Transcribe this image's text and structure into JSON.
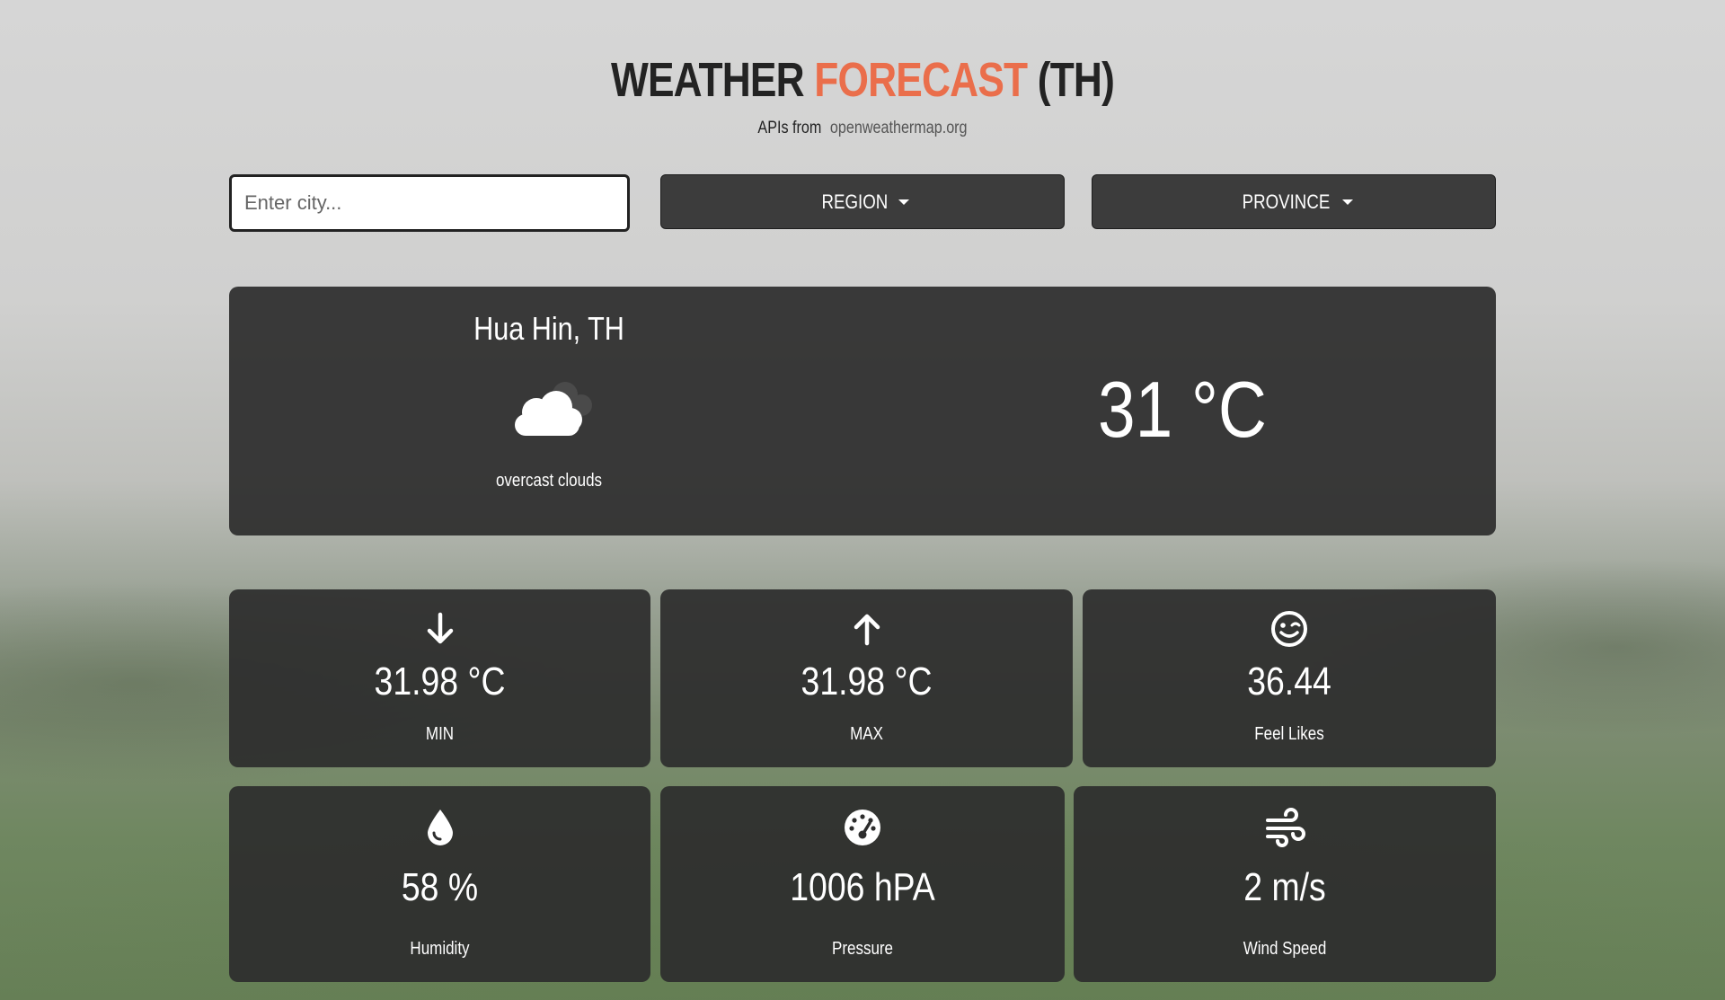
{
  "header": {
    "title_part1": "WEATHER",
    "title_part2": "FORECAST",
    "title_part3": "(TH)",
    "subtitle_prefix": "APIs from",
    "subtitle_link": "openweathermap.org",
    "accent_color": "#ea6e4b"
  },
  "search": {
    "placeholder": "Enter city...",
    "value": ""
  },
  "dropdowns": {
    "region_label": "REGION",
    "province_label": "PROVINCE"
  },
  "current": {
    "city": "Hua Hin, TH",
    "icon": "cloud-icon",
    "description": "overcast clouds",
    "temperature": "31 °C"
  },
  "stats": {
    "min": {
      "icon": "arrow-down-icon",
      "value": "31.98 °C",
      "label": "MIN"
    },
    "max": {
      "icon": "arrow-up-icon",
      "value": "31.98 °C",
      "label": "MAX"
    },
    "feels_like": {
      "icon": "smile-wink-icon",
      "value": "36.44",
      "label": "Feel Likes"
    },
    "humidity": {
      "icon": "droplet-icon",
      "value": "58 %",
      "label": "Humidity"
    },
    "pressure": {
      "icon": "gauge-icon",
      "value": "1006 hPA",
      "label": "Pressure"
    },
    "wind": {
      "icon": "wind-icon",
      "value": "2 m/s",
      "label": "Wind Speed"
    }
  }
}
